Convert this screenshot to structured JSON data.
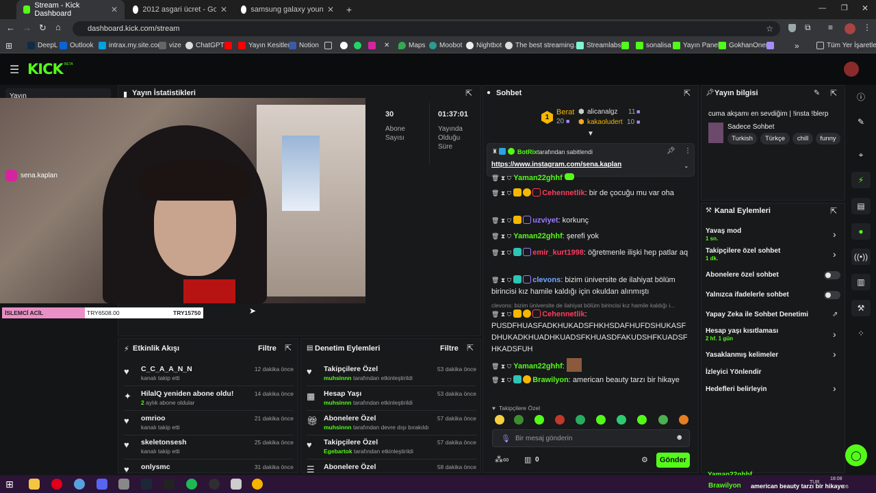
{
  "browser": {
    "tabs": [
      {
        "title": "Stream - Kick Dashboard",
        "active": true
      },
      {
        "title": "2012 asgari ücret - Google'da A",
        "active": false
      },
      {
        "title": "samsung galaxy young - Googl",
        "active": false
      }
    ],
    "url": "dashboard.kick.com/stream",
    "bookmarks": [
      "DeepL",
      "Outlook",
      "intrax.my.site.com",
      "vize",
      "ChatGPT",
      "Yayın Kesitleri",
      "Notion",
      "Maps",
      "Moobot",
      "Nightbot",
      "The best streaming...",
      "Streamlabs",
      "sonalisa",
      "Yayın Paneli",
      "GokhanOner"
    ],
    "all_bookmarks": "Tüm Yer İşaretleri"
  },
  "kick": {
    "logo": "KICK",
    "logo_beta": "BETA",
    "sidebar_item": "Yayın",
    "stats": {
      "title": "Yayın İstatistikleri",
      "subs_value": "30",
      "subs_label": "Abone Sayısı",
      "time_value": "01:37:01",
      "time_label": "Yayında Olduğu Süre"
    },
    "video": {
      "instagram_handle": "sena.kaplan",
      "overlay_label": "İSLEMCİ ACİL",
      "overlay_amount1": "TRY6508.00",
      "overlay_amount2": "TRY15750"
    },
    "activity": {
      "title": "Etkinlik Akışı",
      "filter": "Filtre",
      "items": [
        {
          "title": "C_C_A_A_N_N",
          "sub": "kanalı takip etti",
          "time": "12 dakika önce"
        },
        {
          "title": "HilalQ yeniden abone oldu!",
          "sub_count": "2",
          "sub": "aylık abone oldular",
          "time": "14 dakika önce"
        },
        {
          "title": "omrioo",
          "sub": "kanalı takip etti",
          "time": "21 dakika önce"
        },
        {
          "title": "skeletonsesh",
          "sub": "kanalı takip etti",
          "time": "25 dakika önce"
        },
        {
          "title": "onlysmc",
          "sub": "",
          "time": "31 dakika önce"
        }
      ]
    },
    "moderation": {
      "title": "Denetim Eylemleri",
      "filter": "Filtre",
      "items": [
        {
          "title": "Takipçilere Özel",
          "user": "muhsinnn",
          "sub": "tarafından etkinleştirildi",
          "time": "53 dakika önce"
        },
        {
          "title": "Hesap Yaşı",
          "user": "muhsinnn",
          "sub": "tarafından etkinleştirildi",
          "time": "53 dakika önce"
        },
        {
          "title": "Abonelere Özel",
          "user": "muhsinnn",
          "sub": "tarafından devre dışı bırakıldı",
          "time": "57 dakika önce"
        },
        {
          "title": "Takipçilere Özel",
          "user": "Egebartok",
          "sub": "tarafından etkinleştirildi",
          "time": "57 dakika önce"
        },
        {
          "title": "Abonelere Özel",
          "user": "",
          "sub": "",
          "time": "58 dakika önce"
        }
      ]
    },
    "chat": {
      "title": "Sohbet",
      "top_gifters": [
        {
          "name": "Berat",
          "count": "20"
        },
        {
          "name": "alicanalgz",
          "count": "11"
        },
        {
          "name": "kakaoludert",
          "count": "10"
        }
      ],
      "pinned_by": "BotRix",
      "pinned_label": "tarafından sabitlendi",
      "pinned_link": "https://www.instagram.com/sena.kaplan",
      "messages": [
        {
          "user": "Yaman22ghhf",
          "text": "",
          "color": "#53fc18"
        },
        {
          "user": "Cehennetlik",
          "text": "bir de çocuğu mu var oha",
          "color": "#ff3b5c"
        },
        {
          "user": "uzviyet",
          "text": "korkunç",
          "color": "#9b7bff"
        },
        {
          "user": "Yaman22ghhf",
          "text": "şerefi yok",
          "color": "#53fc18"
        },
        {
          "user": "emir_kurt1998",
          "text": "öğretmenle ilişki hep patlar aq",
          "color": "#ff3b5c"
        },
        {
          "user": "clevons",
          "text": "bizim üniversite de ilahiyat bölüm birincisi kız hamile kaldığı için okuldan alınmıştı",
          "color": "#6fa8ff"
        },
        {
          "reply": "clevons: bizim üniversite de ilahiyat bölüm birincisi kız hamile kaldığı i...",
          "user": "Cehennetlik",
          "text": "PUSDFHUASFADKHUKADSFHKHSDAFHUFDSHUKASFDHUKADKHUADHKUADSFKHUASDFAKUDSHFKUADSFHKADSFUH",
          "color": "#ff3b5c"
        },
        {
          "user": "Yaman22ghhf",
          "text": "",
          "color": "#53fc18"
        },
        {
          "user": "Brawilyon",
          "text": "american beauty tarzı bir hikaye",
          "color": "#53fc18"
        }
      ],
      "follower_only": "Takipçilere Özel",
      "input_placeholder": "Bir mesaj gönderin",
      "points": "0",
      "send": "Gönder"
    },
    "stream_info": {
      "title": "Yayın bilgisi",
      "stream_title": "cuma akşamı en sevdiğim | !insta !blerp",
      "category": "Sadece Sohbet",
      "tags": [
        "Turkish",
        "Türkçe",
        "chill",
        "funny"
      ]
    },
    "channel_actions": {
      "title": "Kanal Eylemleri",
      "items": [
        {
          "label": "Yavaş mod",
          "sub": "1 sn."
        },
        {
          "label": "Takipçilere özel sohbet",
          "sub": "1 dk."
        },
        {
          "label": "Abonelere özel sohbet",
          "sub": ""
        },
        {
          "label": "Yalnızca ifadelerle sohbet",
          "sub": ""
        },
        {
          "label": "Yapay Zeka ile Sohbet Denetimi",
          "sub": ""
        },
        {
          "label": "Hesap yaşı kısıtlaması",
          "sub": "2 hf. 1 gün"
        },
        {
          "label": "Yasaklanmış kelimeler",
          "sub": ""
        },
        {
          "label": "İzleyici Yönlendir",
          "sub": ""
        },
        {
          "label": "Hedefleri belirleyin",
          "sub": ""
        }
      ]
    },
    "overlay_chat": [
      {
        "user": "Yaman22ghhf",
        "text": ""
      },
      {
        "user": "Brawilyon",
        "text": "american beauty tarzı bir hikaye"
      }
    ]
  },
  "taskbar": {
    "time": "18:08",
    "lang": "TUR",
    "date": "26"
  }
}
